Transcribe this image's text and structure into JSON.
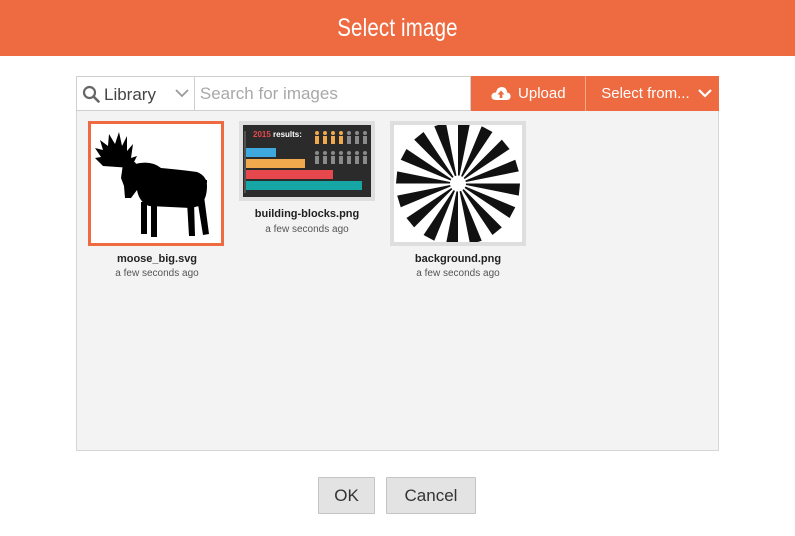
{
  "header": {
    "title": "Select image"
  },
  "toolbar": {
    "source_label": "Library",
    "search_placeholder": "Search for images",
    "search_value": "",
    "upload_label": "Upload",
    "select_from_label": "Select from..."
  },
  "images": [
    {
      "name": "moose_big.svg",
      "time": "a few seconds ago",
      "selected": true
    },
    {
      "name": "building-blocks.png",
      "time": "a few seconds ago",
      "selected": false,
      "thumb_text": {
        "year": "2015",
        "rest": " results:"
      }
    },
    {
      "name": "background.png",
      "time": "a few seconds ago",
      "selected": false
    }
  ],
  "footer": {
    "ok_label": "OK",
    "cancel_label": "Cancel"
  },
  "colors": {
    "accent": "#ee6a41",
    "panel": "#f3f3f3"
  }
}
